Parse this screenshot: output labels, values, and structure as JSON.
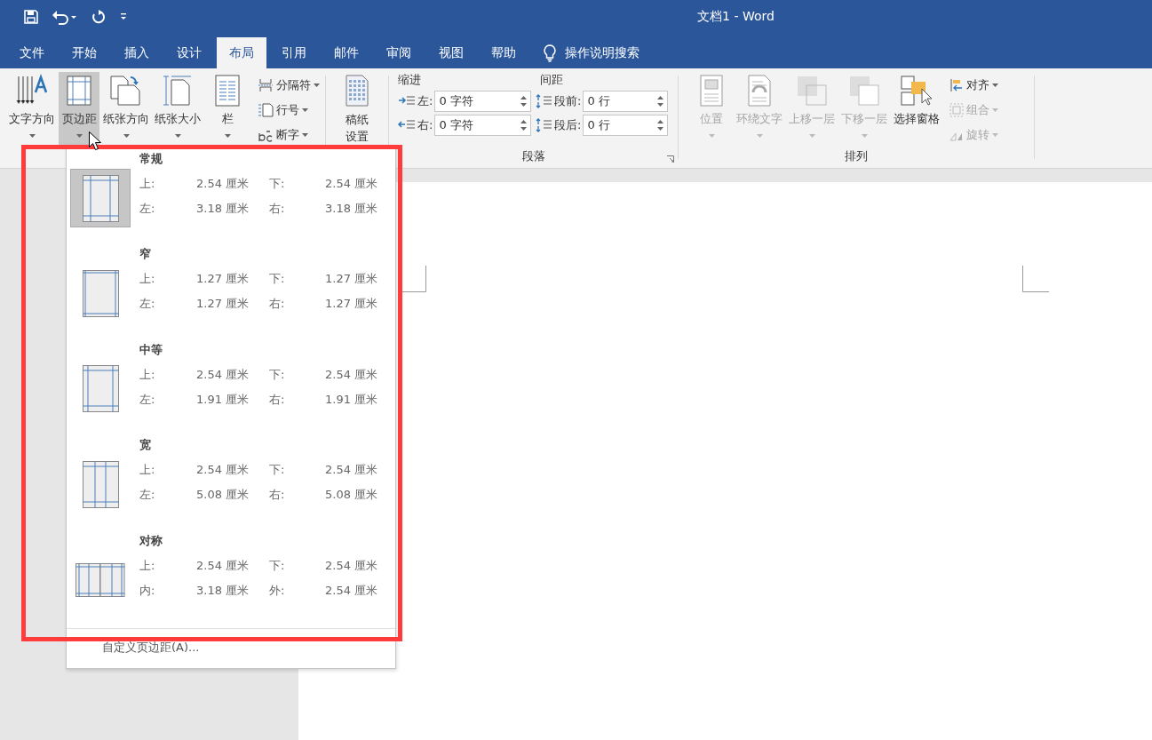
{
  "window": {
    "title": "文档1 - Word"
  },
  "quick_access": [
    {
      "kind": "save"
    },
    {
      "kind": "undo"
    },
    {
      "kind": "redo"
    },
    {
      "kind": "customize"
    }
  ],
  "tabs": [
    {
      "label": "文件",
      "selected": false
    },
    {
      "label": "开始",
      "selected": false
    },
    {
      "label": "插入",
      "selected": false
    },
    {
      "label": "设计",
      "selected": false
    },
    {
      "label": "布局",
      "selected": true
    },
    {
      "label": "引用",
      "selected": false
    },
    {
      "label": "邮件",
      "selected": false
    },
    {
      "label": "审阅",
      "selected": false
    },
    {
      "label": "视图",
      "selected": false
    },
    {
      "label": "帮助",
      "selected": false
    }
  ],
  "tell_me": {
    "label": "操作说明搜索"
  },
  "page_setup": {
    "buttons": [
      {
        "label": "文字方向",
        "kind": "text_direction",
        "pressed": false
      },
      {
        "label": "页边距",
        "kind": "margins",
        "pressed": true
      },
      {
        "label": "纸张方向",
        "kind": "orientation",
        "pressed": false
      },
      {
        "label": "纸张大小",
        "kind": "size",
        "pressed": false
      },
      {
        "label": "栏",
        "kind": "columns",
        "pressed": false
      }
    ],
    "small_buttons": [
      {
        "label": "分隔符",
        "kind": "breaks"
      },
      {
        "label": "行号",
        "kind": "line_numbers"
      },
      {
        "label": "断字",
        "kind": "hyphenation"
      }
    ]
  },
  "manuscript": {
    "label_lines": [
      "稿纸",
      "设置"
    ]
  },
  "paragraph": {
    "indent_label": "缩进",
    "spacing_label": "间距",
    "group_label": "段落",
    "fields": [
      {
        "label": "左:",
        "value": "0 字符",
        "kind": "indent_left"
      },
      {
        "label": "段前:",
        "value": "0 行",
        "kind": "space_before"
      },
      {
        "label": "右:",
        "value": "0 字符",
        "kind": "indent_right"
      },
      {
        "label": "段后:",
        "value": "0 行",
        "kind": "space_after"
      }
    ]
  },
  "arrange": {
    "group_label": "排列",
    "buttons": [
      {
        "label": "位置",
        "kind": "position",
        "disabled": true
      },
      {
        "label": "环绕文字",
        "kind": "wrap",
        "disabled": true
      },
      {
        "label": "上移一层",
        "kind": "forward",
        "disabled": true
      },
      {
        "label": "下移一层",
        "kind": "backward",
        "disabled": true
      },
      {
        "label": "选择窗格",
        "kind": "pane",
        "disabled": false
      }
    ],
    "small_buttons": [
      {
        "label": "对齐",
        "kind": "align",
        "disabled": false
      },
      {
        "label": "组合",
        "kind": "group",
        "disabled": true
      },
      {
        "label": "旋转",
        "kind": "rotate",
        "disabled": true
      }
    ]
  },
  "margins_menu": {
    "highlighted": true,
    "items": [
      {
        "name": "常规",
        "kind": "normal",
        "selected": true,
        "rows": [
          [
            {
              "label": "上:",
              "value": "2.54 厘米"
            },
            {
              "label": "下:",
              "value": "2.54 厘米"
            }
          ],
          [
            {
              "label": "左:",
              "value": "3.18 厘米"
            },
            {
              "label": "右:",
              "value": "3.18 厘米"
            }
          ]
        ]
      },
      {
        "name": "窄",
        "kind": "narrow",
        "selected": false,
        "rows": [
          [
            {
              "label": "上:",
              "value": "1.27 厘米"
            },
            {
              "label": "下:",
              "value": "1.27 厘米"
            }
          ],
          [
            {
              "label": "左:",
              "value": "1.27 厘米"
            },
            {
              "label": "右:",
              "value": "1.27 厘米"
            }
          ]
        ]
      },
      {
        "name": "中等",
        "kind": "moderate",
        "selected": false,
        "rows": [
          [
            {
              "label": "上:",
              "value": "2.54 厘米"
            },
            {
              "label": "下:",
              "value": "2.54 厘米"
            }
          ],
          [
            {
              "label": "左:",
              "value": "1.91 厘米"
            },
            {
              "label": "右:",
              "value": "1.91 厘米"
            }
          ]
        ]
      },
      {
        "name": "宽",
        "kind": "wide",
        "selected": false,
        "rows": [
          [
            {
              "label": "上:",
              "value": "2.54 厘米"
            },
            {
              "label": "下:",
              "value": "2.54 厘米"
            }
          ],
          [
            {
              "label": "左:",
              "value": "5.08 厘米"
            },
            {
              "label": "右:",
              "value": "5.08 厘米"
            }
          ]
        ]
      },
      {
        "name": "对称",
        "kind": "mirrored",
        "selected": false,
        "rows": [
          [
            {
              "label": "上:",
              "value": "2.54 厘米"
            },
            {
              "label": "下:",
              "value": "2.54 厘米"
            }
          ],
          [
            {
              "label": "内:",
              "value": "3.18 厘米"
            },
            {
              "label": "外:",
              "value": "2.54 厘米"
            }
          ]
        ]
      }
    ],
    "footer": "自定义页边距(A)..."
  }
}
